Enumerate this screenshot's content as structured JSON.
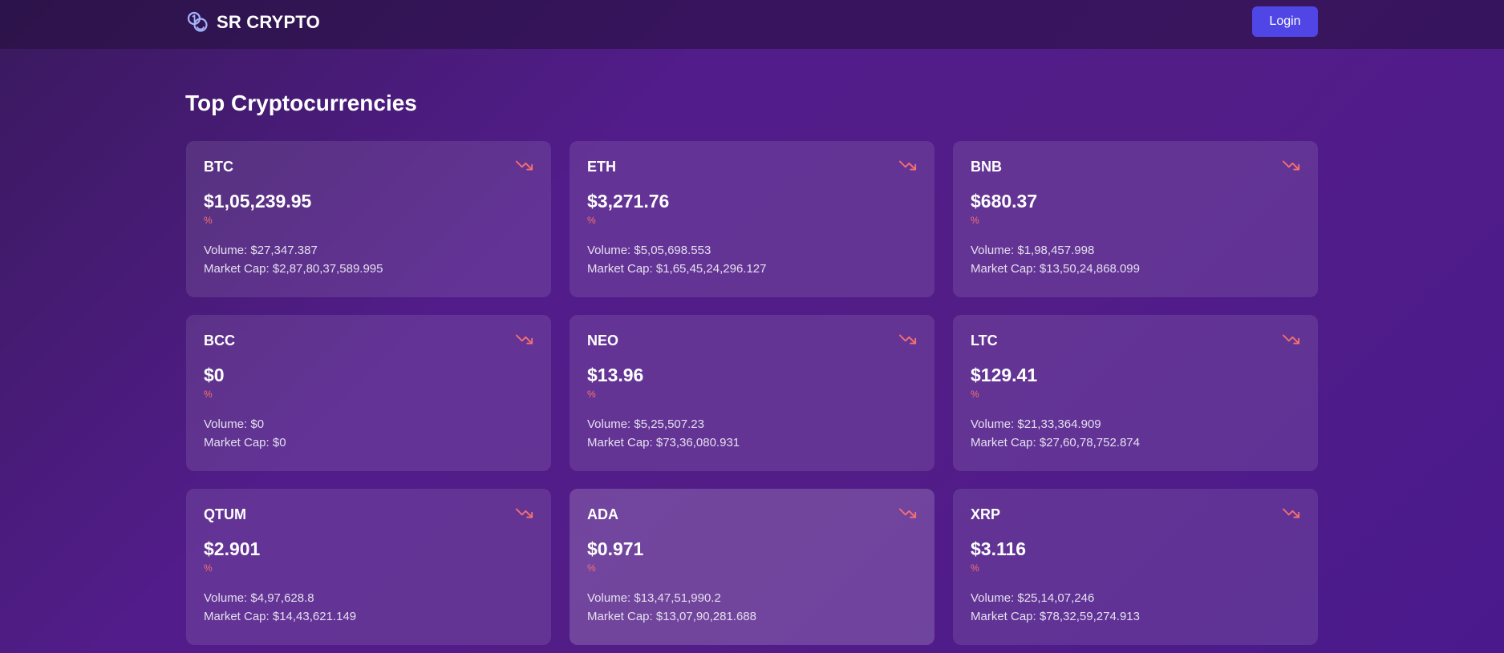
{
  "header": {
    "brand": "SR CRYPTO",
    "login_label": "Login"
  },
  "main": {
    "title": "Top Cryptocurrencies"
  },
  "colors": {
    "accent": "#4f46e5",
    "negative": "#f87171",
    "brand_icon": "#a5b4fc"
  },
  "icons": {
    "brand": "coins-icon",
    "trend": "trending-down-icon"
  },
  "cards": [
    {
      "symbol": "BTC",
      "price": "$1,05,239.95",
      "change": "%",
      "volume": "Volume: $27,347.387",
      "market_cap": "Market Cap: $2,87,80,37,589.995",
      "trend": "down"
    },
    {
      "symbol": "ETH",
      "price": "$3,271.76",
      "change": "%",
      "volume": "Volume: $5,05,698.553",
      "market_cap": "Market Cap: $1,65,45,24,296.127",
      "trend": "down"
    },
    {
      "symbol": "BNB",
      "price": "$680.37",
      "change": "%",
      "volume": "Volume: $1,98,457.998",
      "market_cap": "Market Cap: $13,50,24,868.099",
      "trend": "down"
    },
    {
      "symbol": "BCC",
      "price": "$0",
      "change": "%",
      "volume": "Volume: $0",
      "market_cap": "Market Cap: $0",
      "trend": "down"
    },
    {
      "symbol": "NEO",
      "price": "$13.96",
      "change": "%",
      "volume": "Volume: $5,25,507.23",
      "market_cap": "Market Cap: $73,36,080.931",
      "trend": "down"
    },
    {
      "symbol": "LTC",
      "price": "$129.41",
      "change": "%",
      "volume": "Volume: $21,33,364.909",
      "market_cap": "Market Cap: $27,60,78,752.874",
      "trend": "down"
    },
    {
      "symbol": "QTUM",
      "price": "$2.901",
      "change": "%",
      "volume": "Volume: $4,97,628.8",
      "market_cap": "Market Cap: $14,43,621.149",
      "trend": "down"
    },
    {
      "symbol": "ADA",
      "price": "$0.971",
      "change": "%",
      "volume": "Volume: $13,47,51,990.2",
      "market_cap": "Market Cap: $13,07,90,281.688",
      "trend": "down"
    },
    {
      "symbol": "XRP",
      "price": "$3.116",
      "change": "%",
      "volume": "Volume: $25,14,07,246",
      "market_cap": "Market Cap: $78,32,59,274.913",
      "trend": "down"
    }
  ]
}
